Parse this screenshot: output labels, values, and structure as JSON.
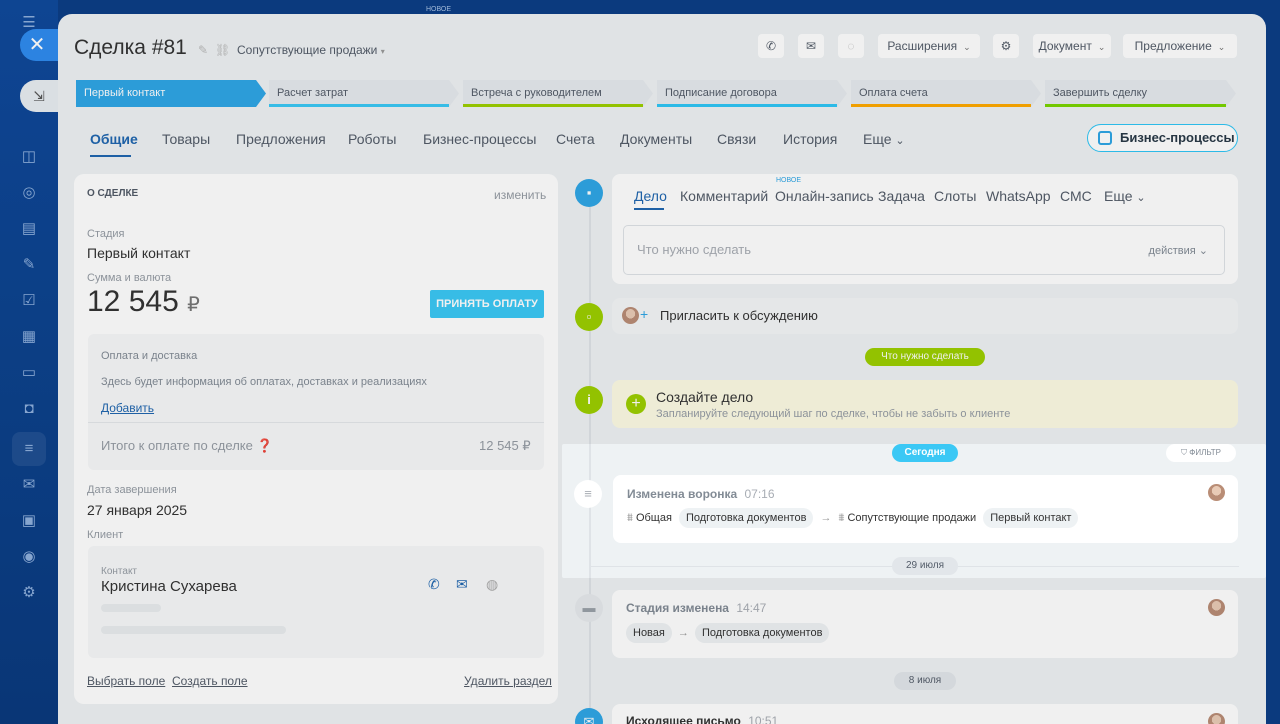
{
  "appbar": {
    "close_icon": "close-icon",
    "pin_icon": "pin-icon",
    "new_badge": "НОВОЕ"
  },
  "header": {
    "title": "Сделка #81",
    "category": "Сопутствующие продажи",
    "extensions_label": "Расширения",
    "document_label": "Документ",
    "offer_label": "Предложение"
  },
  "stages": [
    {
      "label": "Первый контакт",
      "color": "#2fa6e6"
    },
    {
      "label": "Расчет затрат",
      "color": "#3bc8f5"
    },
    {
      "label": "Встреча с руководителем",
      "color": "#9dcf00"
    },
    {
      "label": "Подписание договора",
      "color": "#2fc6f6"
    },
    {
      "label": "Оплата счета",
      "color": "#ffa900"
    },
    {
      "label": "Завершить сделку",
      "color": "#7bd500"
    }
  ],
  "tabs": [
    "Общие",
    "Товары",
    "Предложения",
    "Роботы",
    "Бизнес-процессы",
    "Счета",
    "Документы",
    "Связи",
    "История",
    "Еще"
  ],
  "bp_button_label": "Бизнес-процессы",
  "about": {
    "title": "О СДЕЛКЕ",
    "edit_link": "изменить",
    "stage_label": "Стадия",
    "stage_value": "Первый контакт",
    "sum_label": "Сумма и валюта",
    "sum_value": "12 545",
    "currency": "₽",
    "pay_button": "ПРИНЯТЬ ОПЛАТУ",
    "payment_title": "Оплата и доставка",
    "payment_info": "Здесь будет информация об оплатах, доставках и реализациях",
    "add_link": "Добавить",
    "total_label": "Итого к оплате по сделке",
    "total_value": "12 545 ₽",
    "close_date_label": "Дата завершения",
    "close_date_value": "27 января 2025",
    "client_label": "Клиент",
    "contact_label": "Контакт",
    "contact_name": "Кристина Сухарева",
    "select_field": "Выбрать поле",
    "create_field": "Создать поле",
    "delete_section": "Удалить раздел"
  },
  "editor": {
    "tabs": [
      "Дело",
      "Комментарий",
      "Онлайн-запись",
      "Задача",
      "Слоты",
      "WhatsApp",
      "СМС",
      "Еще"
    ],
    "new_badge": "НОВОЕ",
    "placeholder": "Что нужно сделать",
    "actions_label": "действия"
  },
  "invite_label": "Пригласить к обсуждению",
  "todo_pill": "Что нужно сделать",
  "create_task": {
    "title": "Создайте дело",
    "subtitle": "Запланируйте следующий шаг по сделке, чтобы не забыть о клиенте"
  },
  "today_pill": "Сегодня",
  "filter_label": "ФИЛЬТР",
  "event_funnel": {
    "title": "Изменена воронка",
    "time": "07:16",
    "from_funnel": "Общая",
    "from_stage": "Подготовка документов",
    "to_funnel": "Сопутствующие продажи",
    "to_stage": "Первый контакт"
  },
  "date_july29": "29 июля",
  "event_stage": {
    "title": "Стадия изменена",
    "time": "14:47",
    "from_stage": "Новая",
    "to_stage": "Подготовка документов"
  },
  "date_july8": "8 июля",
  "event_email": {
    "title": "Исходящее письмо",
    "time": "10:51"
  },
  "colors": {
    "accent": "#2fa6e6",
    "green": "#9dcf00",
    "link": "#2067b0"
  }
}
